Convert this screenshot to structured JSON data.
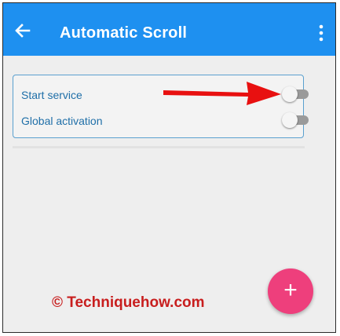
{
  "appbar": {
    "title": "Automatic Scroll",
    "back_icon": "arrow-left-icon",
    "menu_icon": "more-vert-icon",
    "color": "#1e90f0"
  },
  "settings": {
    "items": [
      {
        "label": "Start service",
        "enabled": false
      },
      {
        "label": "Global activation",
        "enabled": false
      }
    ]
  },
  "fab": {
    "label": "+",
    "color": "#ee3f7c"
  },
  "watermark": {
    "text": "© Techniquehow.com",
    "color": "#c81e1e"
  },
  "annotation": {
    "arrow_color": "#e81010"
  }
}
